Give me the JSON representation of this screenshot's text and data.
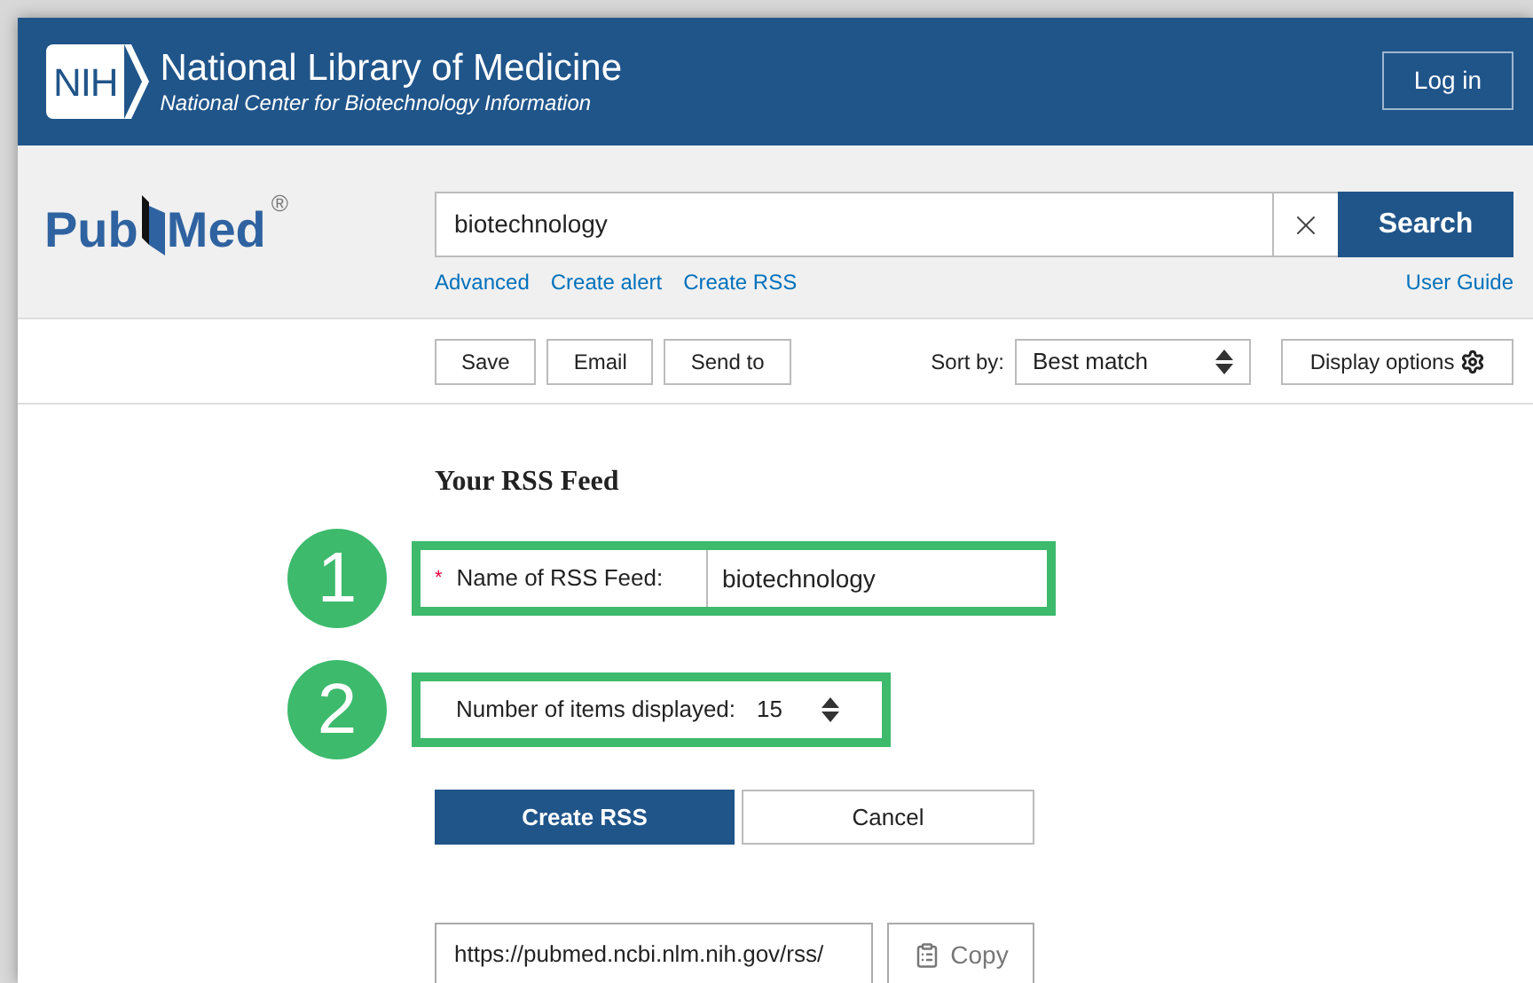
{
  "header": {
    "logo_text": "NIH",
    "title": "National Library of Medicine",
    "subtitle": "National Center for Biotechnology Information",
    "login": "Log in"
  },
  "search": {
    "logo": {
      "left": "Pub",
      "right": "Med",
      "mark": "®"
    },
    "value": "biotechnology",
    "button": "Search",
    "links": [
      "Advanced",
      "Create alert",
      "Create RSS"
    ],
    "guide": "User Guide"
  },
  "toolbar": {
    "buttons": [
      "Save",
      "Email",
      "Send to"
    ],
    "sort_label": "Sort by:",
    "sort_value": "Best match",
    "display": "Display options"
  },
  "rss": {
    "heading": "Your RSS Feed",
    "steps": [
      {
        "number": "1",
        "kind": "text",
        "required_mark": "*",
        "label": "Name of RSS Feed:",
        "value": "biotechnology"
      },
      {
        "number": "2",
        "kind": "select",
        "label": "Number of items displayed:",
        "value": "15"
      }
    ],
    "create": "Create RSS",
    "cancel": "Cancel",
    "url": "https://pubmed.ncbi.nlm.nih.gov/rss/",
    "copy": "Copy"
  }
}
